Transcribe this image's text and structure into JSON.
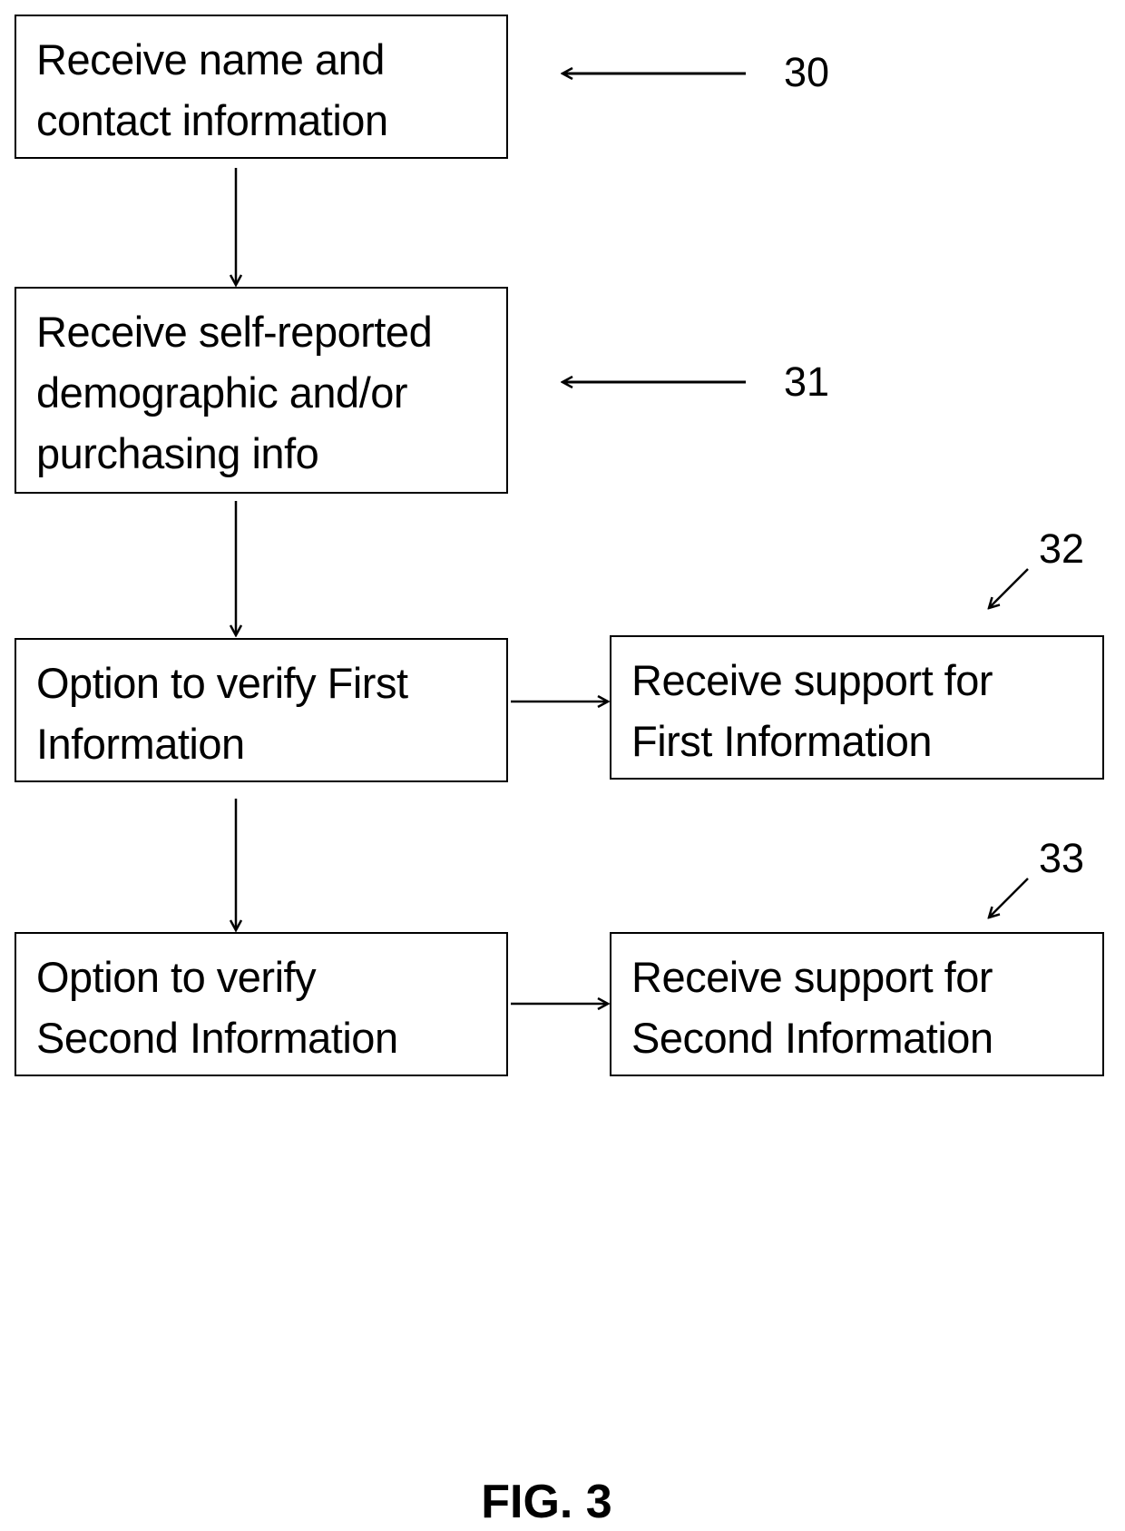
{
  "figure": {
    "caption": "FIG. 3",
    "steps": [
      {
        "id": "step-30",
        "ref": "30",
        "text": "Receive name and\ncontact information"
      },
      {
        "id": "step-31",
        "ref": "31",
        "text": "Receive self-reported\ndemographic and/or\npurchasing info"
      },
      {
        "id": "step-verify-first",
        "ref": "",
        "text": "Option to verify First\nInformation"
      },
      {
        "id": "step-verify-second",
        "ref": "",
        "text": "Option to verify\nSecond Information"
      },
      {
        "id": "step-32",
        "ref": "32",
        "text": "Receive support for\nFirst Information"
      },
      {
        "id": "step-33",
        "ref": "33",
        "text": "Receive support for\nSecond Information"
      }
    ],
    "edges": [
      {
        "from": "step-30",
        "to": "step-31"
      },
      {
        "from": "step-31",
        "to": "step-verify-first"
      },
      {
        "from": "step-verify-first",
        "to": "step-verify-second"
      },
      {
        "from": "step-verify-first",
        "to": "step-32"
      },
      {
        "from": "step-verify-second",
        "to": "step-33"
      }
    ]
  }
}
